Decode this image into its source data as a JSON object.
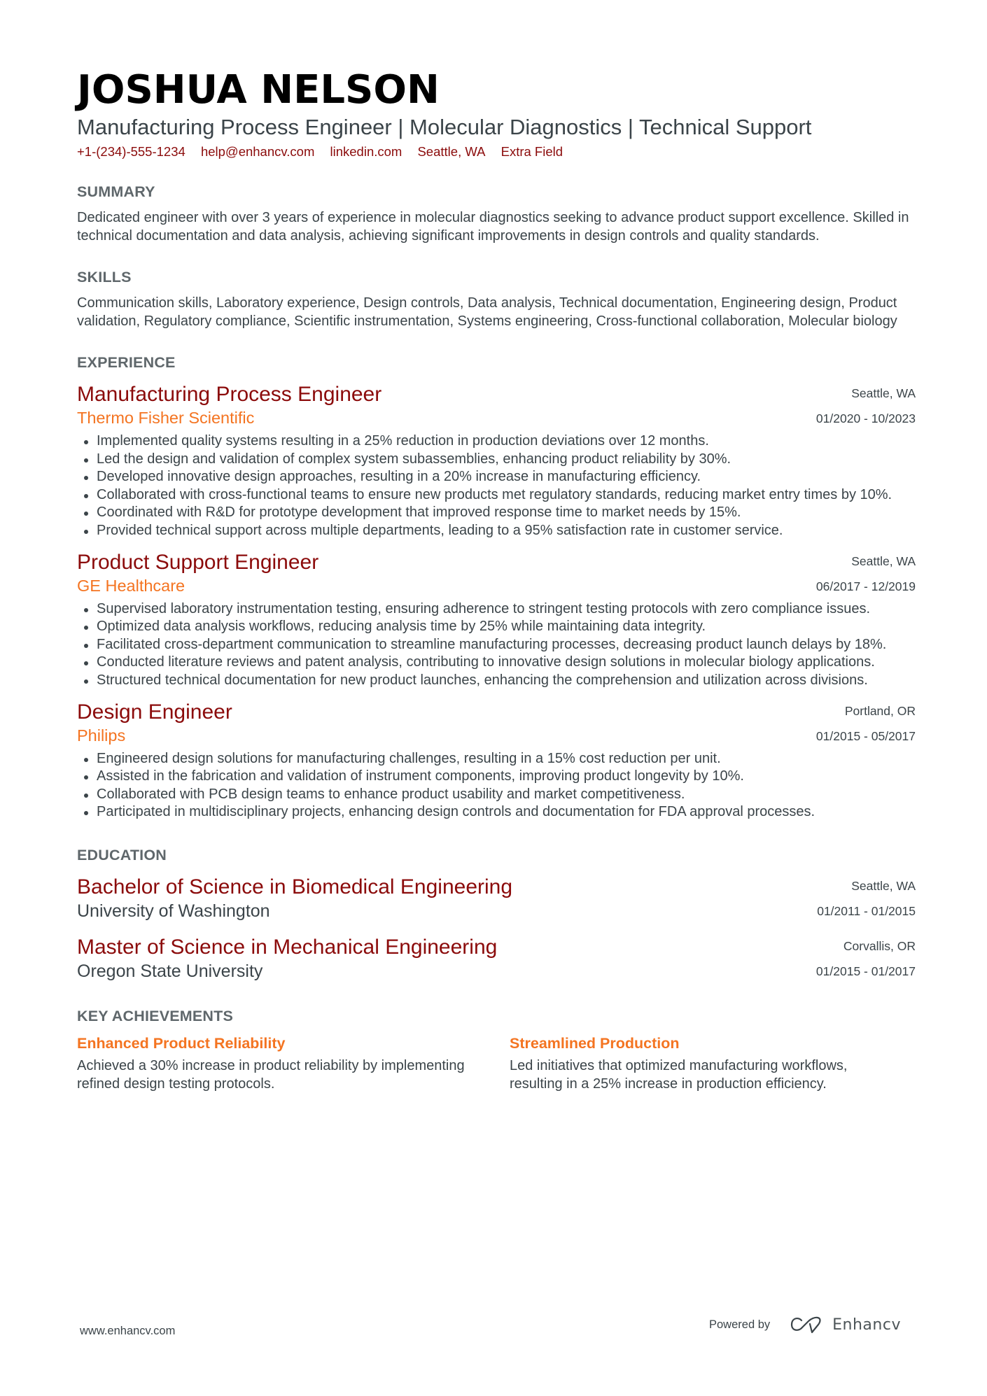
{
  "header": {
    "name": "JOSHUA NELSON",
    "subtitle": "Manufacturing Process Engineer | Molecular Diagnostics | Technical Support",
    "contacts": [
      "+1-(234)-555-1234",
      "help@enhancv.com",
      "linkedin.com",
      "Seattle, WA",
      "Extra Field"
    ]
  },
  "summary": {
    "title": "SUMMARY",
    "text": "Dedicated engineer with over 3 years of experience in molecular diagnostics seeking to advance product support excellence. Skilled in technical documentation and data analysis, achieving significant improvements in design controls and quality standards."
  },
  "skills": {
    "title": "SKILLS",
    "text": "Communication skills, Laboratory experience, Design controls, Data analysis, Technical documentation, Engineering design, Product validation, Regulatory compliance, Scientific instrumentation, Systems engineering, Cross-functional collaboration, Molecular biology"
  },
  "experience": {
    "title": "EXPERIENCE",
    "items": [
      {
        "title": "Manufacturing Process Engineer",
        "company": "Thermo Fisher Scientific",
        "location": "Seattle, WA",
        "dates": "01/2020 - 10/2023",
        "bullets": [
          "Implemented quality systems resulting in a 25% reduction in production deviations over 12 months.",
          "Led the design and validation of complex system subassemblies, enhancing product reliability by 30%.",
          "Developed innovative design approaches, resulting in a 20% increase in manufacturing efficiency.",
          "Collaborated with cross-functional teams to ensure new products met regulatory standards, reducing market entry times by 10%.",
          "Coordinated with R&D for prototype development that improved response time to market needs by 15%.",
          "Provided technical support across multiple departments, leading to a 95% satisfaction rate in customer service."
        ]
      },
      {
        "title": "Product Support Engineer",
        "company": "GE Healthcare",
        "location": "Seattle, WA",
        "dates": "06/2017 - 12/2019",
        "bullets": [
          "Supervised laboratory instrumentation testing, ensuring adherence to stringent testing protocols with zero compliance issues.",
          "Optimized data analysis workflows, reducing analysis time by 25% while maintaining data integrity.",
          "Facilitated cross-department communication to streamline manufacturing processes, decreasing product launch delays by 18%.",
          "Conducted literature reviews and patent analysis, contributing to innovative design solutions in molecular biology applications.",
          "Structured technical documentation for new product launches, enhancing the comprehension and utilization across divisions."
        ]
      },
      {
        "title": "Design Engineer",
        "company": "Philips",
        "location": "Portland, OR",
        "dates": "01/2015 - 05/2017",
        "bullets": [
          "Engineered design solutions for manufacturing challenges, resulting in a 15% cost reduction per unit.",
          "Assisted in the fabrication and validation of instrument components, improving product longevity by 10%.",
          "Collaborated with PCB design teams to enhance product usability and market competitiveness.",
          "Participated in multidisciplinary projects, enhancing design controls and documentation for FDA approval processes."
        ]
      }
    ]
  },
  "education": {
    "title": "EDUCATION",
    "items": [
      {
        "degree": "Bachelor of Science in Biomedical Engineering",
        "school": "University of Washington",
        "location": "Seattle, WA",
        "dates": "01/2011 - 01/2015"
      },
      {
        "degree": "Master of Science in Mechanical Engineering",
        "school": "Oregon State University",
        "location": "Corvallis, OR",
        "dates": "01/2015 - 01/2017"
      }
    ]
  },
  "achievements": {
    "title": "KEY ACHIEVEMENTS",
    "items": [
      {
        "title": "Enhanced Product Reliability",
        "description": "Achieved a 30% increase in product reliability by implementing refined design testing protocols."
      },
      {
        "title": "Streamlined Production",
        "description": "Led initiatives that optimized manufacturing workflows, resulting in a 25% increase in production efficiency."
      }
    ]
  },
  "footer": {
    "website": "www.enhancv.com",
    "powered_by": "Powered by",
    "brand": "Enhancv",
    "brand_icon": "enhancv-logo-icon"
  },
  "colors": {
    "name": "#000000",
    "accent_dark_red": "#8b0b0b",
    "accent_orange": "#f47421",
    "section_heading": "#5f676b",
    "body_text": "#3b4449"
  }
}
